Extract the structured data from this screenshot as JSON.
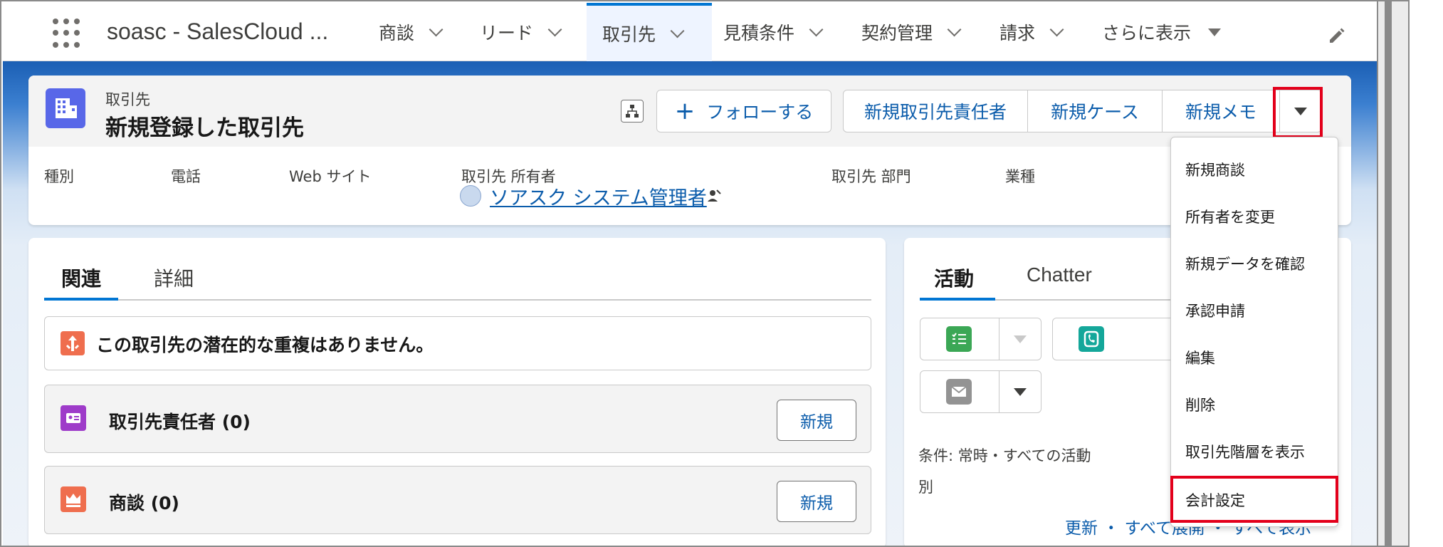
{
  "nav": {
    "app_name": "soasc - SalesCloud ...",
    "items": [
      {
        "label": "商談"
      },
      {
        "label": "リード"
      },
      {
        "label": "取引先"
      },
      {
        "label": "見積条件"
      },
      {
        "label": "契約管理"
      },
      {
        "label": "請求"
      },
      {
        "label": "さらに表示"
      }
    ],
    "active_item": "取引先",
    "accent_color": "#0176d3"
  },
  "record": {
    "object_label": "取引先",
    "title": "新規登録した取引先",
    "buttons": {
      "follow": "フォローする",
      "new_contact": "新規取引先責任者",
      "new_case": "新規ケース",
      "new_note": "新規メモ"
    },
    "highlights": [
      {
        "label": "種別"
      },
      {
        "label": "電話"
      },
      {
        "label": "Web サイト"
      },
      {
        "label": "取引先 所有者"
      },
      {
        "label": "取引先 部門"
      },
      {
        "label": "業種"
      }
    ],
    "owner_name": "ソアスク システム管理者"
  },
  "left_panel": {
    "tabs": [
      {
        "label": "関連"
      },
      {
        "label": "詳細"
      }
    ],
    "duplicate_message": "この取引先の潜在的な重複はありません。",
    "related_lists": [
      {
        "title": "取引先責任者 (0)",
        "new_label": "新規",
        "icon_color": "#9e3bc9"
      },
      {
        "title": "商談 (0)",
        "new_label": "新規",
        "icon_color": "#ef6e4e"
      }
    ]
  },
  "right_panel": {
    "tabs": [
      {
        "label": "活動"
      },
      {
        "label": "Chatter"
      }
    ],
    "filter_text": "条件: 常時・すべての活動",
    "filter_text_wrap": "別",
    "links": "更新 ・ すべて展開 ・ すべて表示"
  },
  "menu": {
    "items": [
      {
        "label": "新規商談"
      },
      {
        "label": "所有者を変更"
      },
      {
        "label": "新規データを確認"
      },
      {
        "label": "承認申請"
      },
      {
        "label": "編集"
      },
      {
        "label": "削除"
      },
      {
        "label": "取引先階層を表示"
      },
      {
        "label": "会計設定"
      }
    ],
    "highlighted_item": "会計設定"
  },
  "colors": {
    "link": "#0b5cab",
    "highlight_red": "#e3001b",
    "object_icon": "#5867e8"
  }
}
